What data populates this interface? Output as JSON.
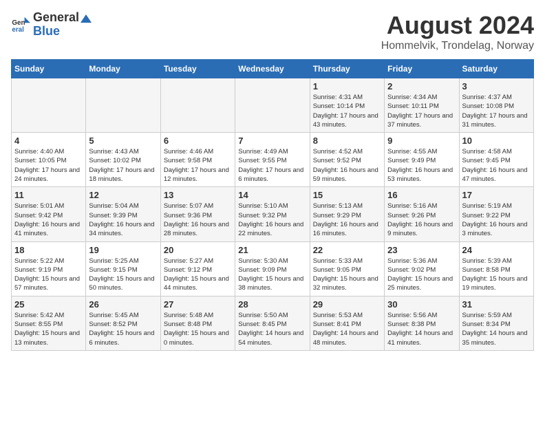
{
  "header": {
    "logo_general": "General",
    "logo_blue": "Blue",
    "month_year": "August 2024",
    "location": "Hommelvik, Trondelag, Norway"
  },
  "days_of_week": [
    "Sunday",
    "Monday",
    "Tuesday",
    "Wednesday",
    "Thursday",
    "Friday",
    "Saturday"
  ],
  "weeks": [
    [
      {
        "day": "",
        "info": ""
      },
      {
        "day": "",
        "info": ""
      },
      {
        "day": "",
        "info": ""
      },
      {
        "day": "",
        "info": ""
      },
      {
        "day": "1",
        "info": "Sunrise: 4:31 AM\nSunset: 10:14 PM\nDaylight: 17 hours\nand 43 minutes."
      },
      {
        "day": "2",
        "info": "Sunrise: 4:34 AM\nSunset: 10:11 PM\nDaylight: 17 hours\nand 37 minutes."
      },
      {
        "day": "3",
        "info": "Sunrise: 4:37 AM\nSunset: 10:08 PM\nDaylight: 17 hours\nand 31 minutes."
      }
    ],
    [
      {
        "day": "4",
        "info": "Sunrise: 4:40 AM\nSunset: 10:05 PM\nDaylight: 17 hours\nand 24 minutes."
      },
      {
        "day": "5",
        "info": "Sunrise: 4:43 AM\nSunset: 10:02 PM\nDaylight: 17 hours\nand 18 minutes."
      },
      {
        "day": "6",
        "info": "Sunrise: 4:46 AM\nSunset: 9:58 PM\nDaylight: 17 hours\nand 12 minutes."
      },
      {
        "day": "7",
        "info": "Sunrise: 4:49 AM\nSunset: 9:55 PM\nDaylight: 17 hours\nand 6 minutes."
      },
      {
        "day": "8",
        "info": "Sunrise: 4:52 AM\nSunset: 9:52 PM\nDaylight: 16 hours\nand 59 minutes."
      },
      {
        "day": "9",
        "info": "Sunrise: 4:55 AM\nSunset: 9:49 PM\nDaylight: 16 hours\nand 53 minutes."
      },
      {
        "day": "10",
        "info": "Sunrise: 4:58 AM\nSunset: 9:45 PM\nDaylight: 16 hours\nand 47 minutes."
      }
    ],
    [
      {
        "day": "11",
        "info": "Sunrise: 5:01 AM\nSunset: 9:42 PM\nDaylight: 16 hours\nand 41 minutes."
      },
      {
        "day": "12",
        "info": "Sunrise: 5:04 AM\nSunset: 9:39 PM\nDaylight: 16 hours\nand 34 minutes."
      },
      {
        "day": "13",
        "info": "Sunrise: 5:07 AM\nSunset: 9:36 PM\nDaylight: 16 hours\nand 28 minutes."
      },
      {
        "day": "14",
        "info": "Sunrise: 5:10 AM\nSunset: 9:32 PM\nDaylight: 16 hours\nand 22 minutes."
      },
      {
        "day": "15",
        "info": "Sunrise: 5:13 AM\nSunset: 9:29 PM\nDaylight: 16 hours\nand 16 minutes."
      },
      {
        "day": "16",
        "info": "Sunrise: 5:16 AM\nSunset: 9:26 PM\nDaylight: 16 hours\nand 9 minutes."
      },
      {
        "day": "17",
        "info": "Sunrise: 5:19 AM\nSunset: 9:22 PM\nDaylight: 16 hours\nand 3 minutes."
      }
    ],
    [
      {
        "day": "18",
        "info": "Sunrise: 5:22 AM\nSunset: 9:19 PM\nDaylight: 15 hours\nand 57 minutes."
      },
      {
        "day": "19",
        "info": "Sunrise: 5:25 AM\nSunset: 9:15 PM\nDaylight: 15 hours\nand 50 minutes."
      },
      {
        "day": "20",
        "info": "Sunrise: 5:27 AM\nSunset: 9:12 PM\nDaylight: 15 hours\nand 44 minutes."
      },
      {
        "day": "21",
        "info": "Sunrise: 5:30 AM\nSunset: 9:09 PM\nDaylight: 15 hours\nand 38 minutes."
      },
      {
        "day": "22",
        "info": "Sunrise: 5:33 AM\nSunset: 9:05 PM\nDaylight: 15 hours\nand 32 minutes."
      },
      {
        "day": "23",
        "info": "Sunrise: 5:36 AM\nSunset: 9:02 PM\nDaylight: 15 hours\nand 25 minutes."
      },
      {
        "day": "24",
        "info": "Sunrise: 5:39 AM\nSunset: 8:58 PM\nDaylight: 15 hours\nand 19 minutes."
      }
    ],
    [
      {
        "day": "25",
        "info": "Sunrise: 5:42 AM\nSunset: 8:55 PM\nDaylight: 15 hours\nand 13 minutes."
      },
      {
        "day": "26",
        "info": "Sunrise: 5:45 AM\nSunset: 8:52 PM\nDaylight: 15 hours\nand 6 minutes."
      },
      {
        "day": "27",
        "info": "Sunrise: 5:48 AM\nSunset: 8:48 PM\nDaylight: 15 hours\nand 0 minutes."
      },
      {
        "day": "28",
        "info": "Sunrise: 5:50 AM\nSunset: 8:45 PM\nDaylight: 14 hours\nand 54 minutes."
      },
      {
        "day": "29",
        "info": "Sunrise: 5:53 AM\nSunset: 8:41 PM\nDaylight: 14 hours\nand 48 minutes."
      },
      {
        "day": "30",
        "info": "Sunrise: 5:56 AM\nSunset: 8:38 PM\nDaylight: 14 hours\nand 41 minutes."
      },
      {
        "day": "31",
        "info": "Sunrise: 5:59 AM\nSunset: 8:34 PM\nDaylight: 14 hours\nand 35 minutes."
      }
    ]
  ]
}
